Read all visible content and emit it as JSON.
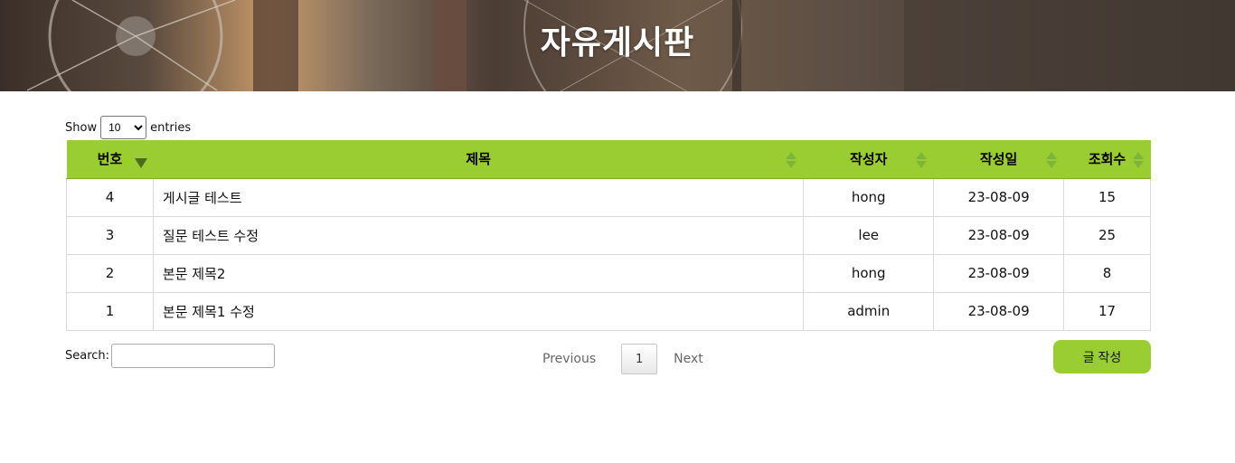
{
  "banner": {
    "title": "자유게시판"
  },
  "length_control": {
    "prefix": "Show",
    "selected": "10",
    "suffix": "entries"
  },
  "table": {
    "headers": [
      "번호",
      "제목",
      "작성자",
      "작성일",
      "조회수"
    ],
    "rows": [
      {
        "no": "4",
        "title": "게시글 테스트",
        "writer": "hong",
        "date": "23-08-09",
        "views": "15"
      },
      {
        "no": "3",
        "title": "질문 테스트 수정",
        "writer": "lee",
        "date": "23-08-09",
        "views": "25"
      },
      {
        "no": "2",
        "title": "본문 제목2",
        "writer": "hong",
        "date": "23-08-09",
        "views": "8"
      },
      {
        "no": "1",
        "title": "본문 제목1 수정",
        "writer": "admin",
        "date": "23-08-09",
        "views": "17"
      }
    ]
  },
  "search": {
    "label": "Search:",
    "value": ""
  },
  "pagination": {
    "previous": "Previous",
    "current_page": "1",
    "next": "Next"
  },
  "write_button": {
    "label": "글 작성"
  },
  "colors": {
    "accent": "#9acd32",
    "sort_icon": "#7db53a",
    "sort_active": "#4d6b1c"
  }
}
